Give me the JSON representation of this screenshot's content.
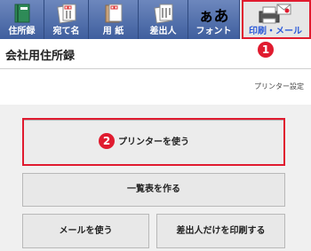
{
  "toolbar": {
    "items": [
      {
        "label": "住所録",
        "icon": "address-book-icon"
      },
      {
        "label": "宛て名",
        "icon": "address-card-icon"
      },
      {
        "label": "用 紙",
        "icon": "paper-icon"
      },
      {
        "label": "差出人",
        "icon": "sender-card-icon"
      },
      {
        "label": "フォント",
        "icon": "font-icon",
        "glyph": "ぁあ"
      },
      {
        "label": "印刷・メール",
        "icon": "printer-mail-icon"
      }
    ]
  },
  "page": {
    "title": "会社用住所録",
    "printer_settings": "プリンター設定"
  },
  "buttons": {
    "use_printer": "プリンターを使う",
    "make_list": "一覧表を作る",
    "use_mail": "メールを使う",
    "print_sender_only": "差出人だけを印刷する"
  },
  "annotations": {
    "step1": "1",
    "step2": "2"
  },
  "colors": {
    "toolbar_bg": "#4d6aa8",
    "highlight": "#e01b2f",
    "active_label": "#2d5bd8"
  }
}
